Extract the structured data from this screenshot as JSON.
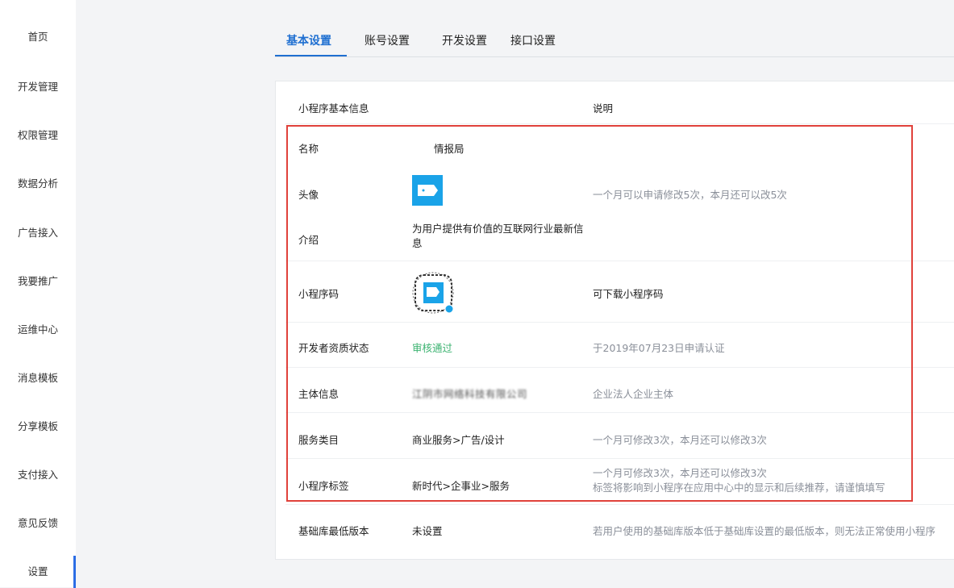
{
  "sidebar": {
    "items": [
      "首页",
      "开发管理",
      "权限管理",
      "数据分析",
      "广告接入",
      "我要推广",
      "运维中心",
      "消息模板",
      "分享模板",
      "支付接入",
      "意见反馈",
      "设置"
    ],
    "active_index": 11
  },
  "tabs": [
    "基本设置",
    "账号设置",
    "开发设置",
    "接口设置"
  ],
  "table": {
    "header": {
      "col1": "小程序基本信息",
      "col3": "说明"
    },
    "rows": {
      "name": {
        "label": "名称",
        "value": "情报局"
      },
      "avatar": {
        "label": "头像",
        "note": "一个月可以申请修改5次，本月还可以改5次"
      },
      "intro": {
        "label": "介绍",
        "value": "为用户提供有价值的互联网行业最新信息"
      },
      "qrcode": {
        "label": "小程序码",
        "note": "可下载小程序码"
      },
      "qualification": {
        "label": "开发者资质状态",
        "value": "审核通过",
        "note": "于2019年07月23日申请认证"
      },
      "subject": {
        "label": "主体信息",
        "value": "江阴市网络科技有限公司",
        "note": "企业法人企业主体"
      },
      "service": {
        "label": "服务类目",
        "value": "商业服务>广告/设计",
        "note": "一个月可修改3次，本月还可以修改3次"
      },
      "tags": {
        "label": "小程序标签",
        "value": "新时代>企事业>服务",
        "note_line1": "一个月可修改3次，本月还可以修改3次",
        "note_line2": "标签将影响到小程序在应用中心中的显示和后续推荐，请谨慎填写"
      },
      "baselib": {
        "label": "基础库最低版本",
        "value": "未设置",
        "note": "若用户使用的基础库版本低于基础库设置的最低版本，则无法正常使用小程序"
      }
    }
  },
  "colors": {
    "accent": "#1f6fd1",
    "highlight_border": "#e0423b",
    "success": "#3cb371",
    "avatar_bg": "#1aa3e8"
  },
  "icons": {
    "avatar": "chat-bubble-avatar-icon",
    "qrcode": "mini-program-code-icon"
  }
}
